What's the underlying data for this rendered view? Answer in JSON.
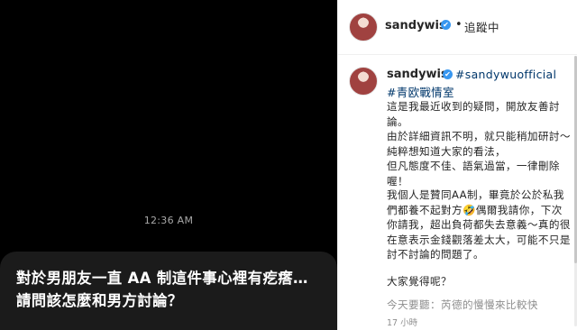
{
  "story": {
    "timestamp": "12:36 AM",
    "question": "對於男朋友一直 AA 制這件事心裡有疙瘩…\n請問該怎麼和男方討論？"
  },
  "header": {
    "username": "sandywis",
    "verified_icon": "✔",
    "separator": "•",
    "follow_label": "追蹤中"
  },
  "caption": {
    "username": "sandywis",
    "verified_icon": "✔",
    "hashtags": [
      "#sandywuofficial",
      "#青欧戰情室"
    ],
    "paragraphs": [
      "這是我最近收到的疑問，開放友善討\n論。\n由於詳細資訊不明，就只能稍加研討～\n純粹想知道大家的看法，\n但凡態度不佳、語氣過當，一律刪除\n喔！",
      "我個人是贊同AA制，畢竟於公於私我\n們都養不起對方🤣偶爾我請你，下次\n你請我，超出負荷都失去意義～真的很\n在意表示金錢觀落差太大，可能不只是\n討不討論的問題了。",
      "大家覺得呢？",
      "今天要聽：芮德的慢慢來比較快"
    ],
    "time_ago": "17 小時"
  },
  "colors": {
    "link": "#00376b",
    "verified": "#3897f0",
    "story_bg": "#000000",
    "bubble_bg": "#1b1b1b"
  }
}
